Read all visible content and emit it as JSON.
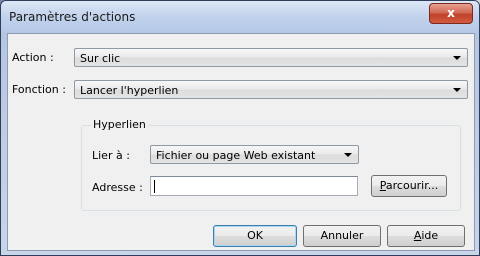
{
  "window": {
    "title": "Paramètres d'actions",
    "close_glyph": "x"
  },
  "action": {
    "label": "Action :",
    "value": "Sur clic"
  },
  "fonction": {
    "label": "Fonction :",
    "value": "Lancer l'hyperlien"
  },
  "hyperlien": {
    "group_title": "Hyperlien",
    "lier_label": "Lier à :",
    "lier_value": "Fichier ou page Web existant",
    "adresse_label": "Adresse :",
    "adresse_value": "",
    "parcourir_first": "P",
    "parcourir_rest": "arcourir..."
  },
  "buttons": {
    "ok": "OK",
    "annuler": "Annuler",
    "aide_first": "A",
    "aide_rest": "ide"
  }
}
